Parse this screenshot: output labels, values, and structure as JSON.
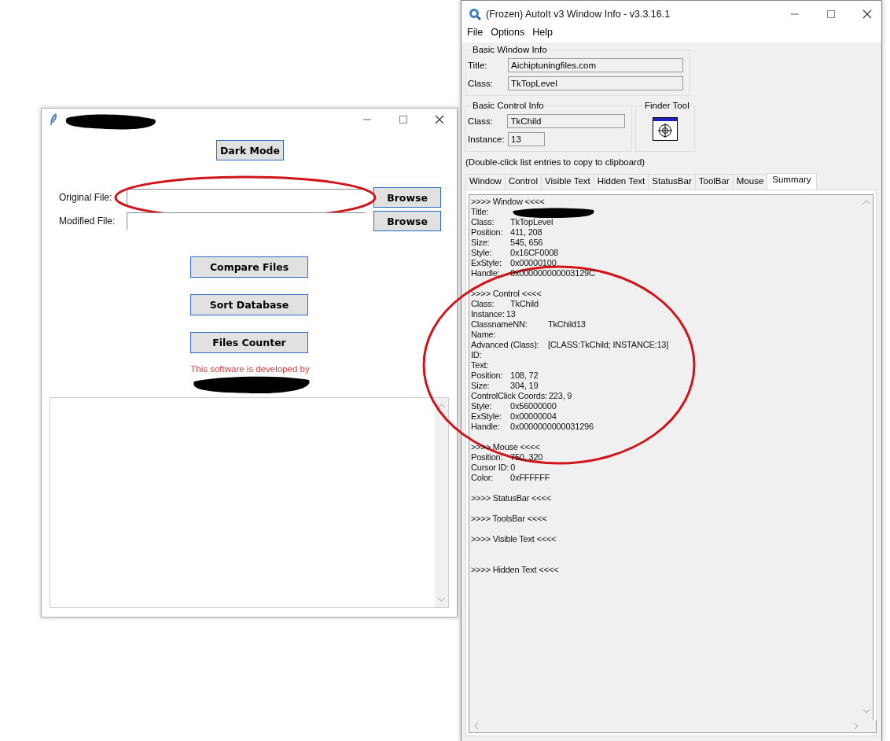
{
  "app_window": {
    "dark_mode_button": "Dark Mode",
    "file_rows": [
      {
        "label": "Original File:",
        "button": "Browse",
        "highlighted": true
      },
      {
        "label": "Modified File:",
        "button": "Browse",
        "highlighted": false
      }
    ],
    "action_buttons": [
      "Compare Files",
      "Sort Database",
      "Files Counter"
    ],
    "credit": "This software is developed by"
  },
  "info_window": {
    "title": "(Frozen) AutoIt v3 Window Info - v3.3.16.1",
    "menu": [
      "File",
      "Options",
      "Help"
    ],
    "basic_window_info": {
      "heading": "Basic Window Info",
      "fields": [
        {
          "label": "Title:",
          "value": "Aichiptuningfiles.com"
        },
        {
          "label": "Class:",
          "value": "TkTopLevel"
        }
      ]
    },
    "basic_control_info": {
      "heading": "Basic Control Info",
      "fields": [
        {
          "label": "Class:",
          "value": "TkChild"
        },
        {
          "label": "Instance:",
          "value": "13"
        }
      ]
    },
    "finder_tool": {
      "heading": "Finder Tool"
    },
    "hint": "(Double-click list entries to copy to clipboard)",
    "tabs": [
      {
        "label": "Window",
        "selected": false
      },
      {
        "label": "Control",
        "selected": false
      },
      {
        "label": "Visible Text",
        "selected": false
      },
      {
        "label": "Hidden Text",
        "selected": false
      },
      {
        "label": "StatusBar",
        "selected": false
      },
      {
        "label": "ToolBar",
        "selected": false
      },
      {
        "label": "Mouse",
        "selected": false
      },
      {
        "label": "Summary",
        "selected": true
      }
    ],
    "summary": [
      {
        "kind": "heading",
        "text": ">>>> Window <<<<"
      },
      {
        "kind": "redacted",
        "label": "Title:"
      },
      {
        "kind": "field",
        "label": "Class:",
        "value": "TkTopLevel"
      },
      {
        "kind": "field",
        "label": "Position:",
        "value": "411, 208"
      },
      {
        "kind": "field",
        "label": "Size:",
        "value": "545, 656"
      },
      {
        "kind": "field",
        "label": "Style:",
        "value": "0x16CF0008"
      },
      {
        "kind": "field",
        "label": "ExStyle:",
        "value": "0x00000100"
      },
      {
        "kind": "field",
        "label": "Handle:",
        "value": "0x000000000003129C"
      },
      {
        "kind": "gap"
      },
      {
        "kind": "heading",
        "text": ">>>> Control <<<<"
      },
      {
        "kind": "field",
        "label": "Class:",
        "value": "TkChild"
      },
      {
        "kind": "tight",
        "label": "Instance:",
        "value": "13"
      },
      {
        "kind": "wide",
        "label": "ClassnameNN:",
        "value": "TkChild13"
      },
      {
        "kind": "label",
        "label": "Name:"
      },
      {
        "kind": "wide",
        "label": "Advanced (Class):",
        "value": "[CLASS:TkChild; INSTANCE:13]"
      },
      {
        "kind": "label",
        "label": "ID:"
      },
      {
        "kind": "label",
        "label": "Text:"
      },
      {
        "kind": "field",
        "label": "Position:",
        "value": "108, 72"
      },
      {
        "kind": "field",
        "label": "Size:",
        "value": "304, 19"
      },
      {
        "kind": "tight",
        "label": "ControlClick Coords:",
        "value": "223, 9"
      },
      {
        "kind": "field",
        "label": "Style:",
        "value": "0x56000000"
      },
      {
        "kind": "field",
        "label": "ExStyle:",
        "value": "0x00000004"
      },
      {
        "kind": "field",
        "label": "Handle:",
        "value": "0x0000000000031296"
      },
      {
        "kind": "gap"
      },
      {
        "kind": "heading",
        "text": ">>>> Mouse <<<<"
      },
      {
        "kind": "field",
        "label": "Position:",
        "value": "750, 320"
      },
      {
        "kind": "tight",
        "label": "Cursor ID:",
        "value": "0"
      },
      {
        "kind": "field",
        "label": "Color:",
        "value": "0xFFFFFF"
      },
      {
        "kind": "gap"
      },
      {
        "kind": "heading",
        "text": ">>>> StatusBar <<<<"
      },
      {
        "kind": "gap"
      },
      {
        "kind": "heading",
        "text": ">>>> ToolsBar <<<<"
      },
      {
        "kind": "gap"
      },
      {
        "kind": "heading",
        "text": ">>>> Visible Text <<<<"
      },
      {
        "kind": "gap"
      },
      {
        "kind": "gap"
      },
      {
        "kind": "heading",
        "text": ">>>> Hidden Text <<<<"
      }
    ],
    "summary_highlighted": true
  }
}
